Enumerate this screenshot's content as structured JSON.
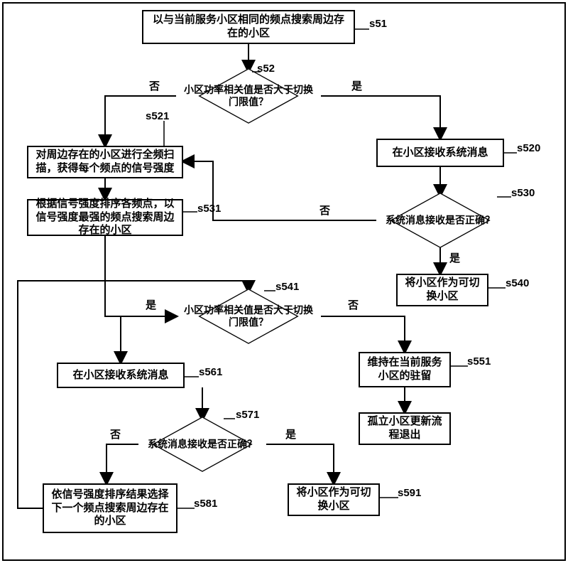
{
  "chart_data": {
    "type": "flowchart",
    "nodes": [
      {
        "id": "s51",
        "kind": "process",
        "text": "以与当前服务小区相同的频点搜索周边存在的小区"
      },
      {
        "id": "s52",
        "kind": "decision",
        "text": "小区功率相关值是否大于切换门限值？"
      },
      {
        "id": "s520",
        "kind": "process",
        "text": "在小区接收系统消息"
      },
      {
        "id": "s521",
        "kind": "process",
        "text": "对周边存在的小区进行全频扫描，获得每个频点的信号强度"
      },
      {
        "id": "s530",
        "kind": "decision",
        "text": "系统消息接收是否正确？"
      },
      {
        "id": "s531",
        "kind": "process",
        "text": "根据信号强度排序各频点，以信号强度最强的频点搜索周边存在的小区"
      },
      {
        "id": "s540",
        "kind": "process",
        "text": "将小区作为可切换小区"
      },
      {
        "id": "s541",
        "kind": "decision",
        "text": "小区功率相关值是否大于切换门限值？"
      },
      {
        "id": "s551",
        "kind": "process",
        "text": "维持在当前服务小区的驻留"
      },
      {
        "id": "s561",
        "kind": "process",
        "text": "在小区接收系统消息"
      },
      {
        "id": "s571",
        "kind": "decision",
        "text": "系统消息接收是否正确？"
      },
      {
        "id": "s581",
        "kind": "process",
        "text": "依信号强度排序结果选择下一个频点搜索周边存在的小区"
      },
      {
        "id": "s591",
        "kind": "process",
        "text": "将小区作为可切换小区"
      },
      {
        "id": "exit",
        "kind": "process",
        "text": "孤立小区更新流程退出"
      }
    ],
    "edges": [
      {
        "from": "s51",
        "to": "s52"
      },
      {
        "from": "s52",
        "to": "s520",
        "label": "是"
      },
      {
        "from": "s52",
        "to": "s521",
        "label": "否"
      },
      {
        "from": "s520",
        "to": "s530"
      },
      {
        "from": "s530",
        "to": "s540",
        "label": "是"
      },
      {
        "from": "s530",
        "to": "s521",
        "label": "否"
      },
      {
        "from": "s521",
        "to": "s531"
      },
      {
        "from": "s531",
        "to": "s541"
      },
      {
        "from": "s541",
        "to": "s561",
        "label": "是"
      },
      {
        "from": "s541",
        "to": "s551",
        "label": "否"
      },
      {
        "from": "s551",
        "to": "exit"
      },
      {
        "from": "s561",
        "to": "s571"
      },
      {
        "from": "s571",
        "to": "s591",
        "label": "是"
      },
      {
        "from": "s571",
        "to": "s581",
        "label": "否"
      },
      {
        "from": "s581",
        "to": "s541"
      }
    ]
  },
  "nodes": {
    "s51": "以与当前服务小区相同的频点搜索周边存在的小区",
    "s52": "小区功率相关值是否大于切换门限值？",
    "s520": "在小区接收系统消息",
    "s521": "对周边存在的小区进行全频扫描，获得每个频点的信号强度",
    "s530": "系统消息接收是否正确？",
    "s531": "根据信号强度排序各频点，以信号强度最强的频点搜索周边存在的小区",
    "s540": "将小区作为可切换小区",
    "s541": "小区功率相关值是否大于切换门限值？",
    "s551": "维持在当前服务小区的驻留",
    "s561": "在小区接收系统消息",
    "s571": "系统消息接收是否正确？",
    "s581": "依信号强度排序结果选择下一个频点搜索周边存在的小区",
    "s591": "将小区作为可切换小区",
    "exit": "孤立小区更新流程退出"
  },
  "labels": {
    "s51": "s51",
    "s52": "s52",
    "s520": "s520",
    "s521": "s521",
    "s530": "s530",
    "s531": "s531",
    "s540": "s540",
    "s541": "s541",
    "s551": "s551",
    "s561": "s561",
    "s571": "s571",
    "s581": "s581",
    "s591": "s591"
  },
  "branch": {
    "yes": "是",
    "no": "否"
  }
}
